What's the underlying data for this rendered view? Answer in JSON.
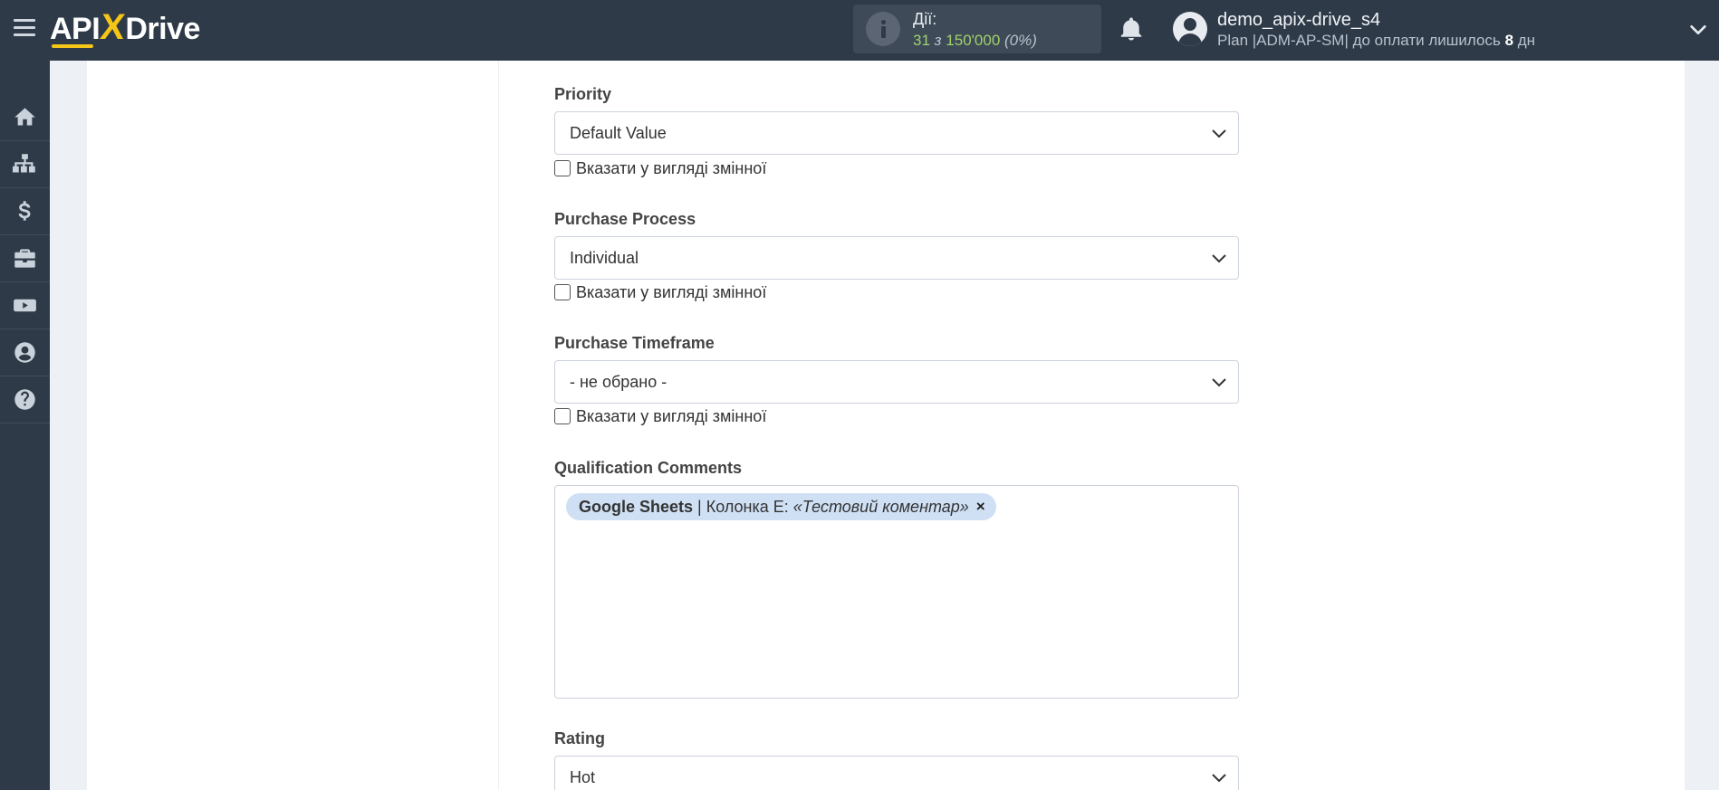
{
  "header": {
    "logo": {
      "pre": "API",
      "x": "X",
      "post": "Drive"
    },
    "actions": {
      "label": "Дії:",
      "count": "31",
      "of": "з",
      "limit": "150'000",
      "percent": "(0%)"
    },
    "user": {
      "name": "demo_apix-drive_s4",
      "plan_text": "Plan |ADM-AP-SM| до оплати лишилось",
      "days": "8",
      "days_unit": "дн"
    }
  },
  "sidebar": {
    "items": [
      {
        "icon": "home-icon"
      },
      {
        "icon": "sitemap-icon"
      },
      {
        "icon": "dollar-icon"
      },
      {
        "icon": "briefcase-icon"
      },
      {
        "icon": "youtube-icon"
      },
      {
        "icon": "user-circle-icon"
      },
      {
        "icon": "question-icon"
      }
    ]
  },
  "form": {
    "checkbox_label": "Вказати у вигляді змінної",
    "priority": {
      "label": "Priority",
      "value": "Default Value"
    },
    "purchase_process": {
      "label": "Purchase Process",
      "value": "Individual"
    },
    "purchase_timeframe": {
      "label": "Purchase Timeframe",
      "value": "- не обрано -"
    },
    "qualification_comments": {
      "label": "Qualification Comments",
      "tag": {
        "source": "Google Sheets",
        "separator": "|",
        "column": "Колонка E:",
        "example": "«Тестовий коментар»",
        "remove": "×"
      }
    },
    "rating": {
      "label": "Rating",
      "value": "Hot"
    }
  }
}
